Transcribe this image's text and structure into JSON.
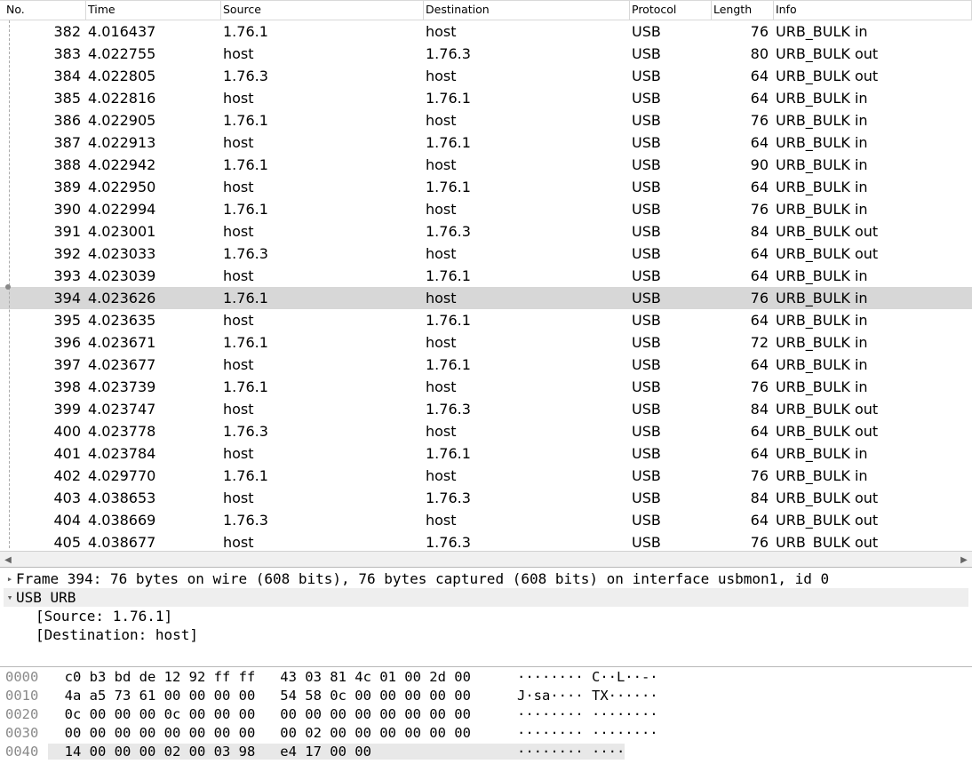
{
  "columns": {
    "no": "No.",
    "time": "Time",
    "source": "Source",
    "destination": "Destination",
    "protocol": "Protocol",
    "length": "Length",
    "info": "Info"
  },
  "selected_no": 394,
  "packets": [
    {
      "no": 382,
      "time": "4.016437",
      "src": "1.76.1",
      "dst": "host",
      "proto": "USB",
      "len": 76,
      "info": "URB_BULK in"
    },
    {
      "no": 383,
      "time": "4.022755",
      "src": "host",
      "dst": "1.76.3",
      "proto": "USB",
      "len": 80,
      "info": "URB_BULK out"
    },
    {
      "no": 384,
      "time": "4.022805",
      "src": "1.76.3",
      "dst": "host",
      "proto": "USB",
      "len": 64,
      "info": "URB_BULK out"
    },
    {
      "no": 385,
      "time": "4.022816",
      "src": "host",
      "dst": "1.76.1",
      "proto": "USB",
      "len": 64,
      "info": "URB_BULK in"
    },
    {
      "no": 386,
      "time": "4.022905",
      "src": "1.76.1",
      "dst": "host",
      "proto": "USB",
      "len": 76,
      "info": "URB_BULK in"
    },
    {
      "no": 387,
      "time": "4.022913",
      "src": "host",
      "dst": "1.76.1",
      "proto": "USB",
      "len": 64,
      "info": "URB_BULK in"
    },
    {
      "no": 388,
      "time": "4.022942",
      "src": "1.76.1",
      "dst": "host",
      "proto": "USB",
      "len": 90,
      "info": "URB_BULK in"
    },
    {
      "no": 389,
      "time": "4.022950",
      "src": "host",
      "dst": "1.76.1",
      "proto": "USB",
      "len": 64,
      "info": "URB_BULK in"
    },
    {
      "no": 390,
      "time": "4.022994",
      "src": "1.76.1",
      "dst": "host",
      "proto": "USB",
      "len": 76,
      "info": "URB_BULK in"
    },
    {
      "no": 391,
      "time": "4.023001",
      "src": "host",
      "dst": "1.76.3",
      "proto": "USB",
      "len": 84,
      "info": "URB_BULK out"
    },
    {
      "no": 392,
      "time": "4.023033",
      "src": "1.76.3",
      "dst": "host",
      "proto": "USB",
      "len": 64,
      "info": "URB_BULK out"
    },
    {
      "no": 393,
      "time": "4.023039",
      "src": "host",
      "dst": "1.76.1",
      "proto": "USB",
      "len": 64,
      "info": "URB_BULK in"
    },
    {
      "no": 394,
      "time": "4.023626",
      "src": "1.76.1",
      "dst": "host",
      "proto": "USB",
      "len": 76,
      "info": "URB_BULK in"
    },
    {
      "no": 395,
      "time": "4.023635",
      "src": "host",
      "dst": "1.76.1",
      "proto": "USB",
      "len": 64,
      "info": "URB_BULK in"
    },
    {
      "no": 396,
      "time": "4.023671",
      "src": "1.76.1",
      "dst": "host",
      "proto": "USB",
      "len": 72,
      "info": "URB_BULK in"
    },
    {
      "no": 397,
      "time": "4.023677",
      "src": "host",
      "dst": "1.76.1",
      "proto": "USB",
      "len": 64,
      "info": "URB_BULK in"
    },
    {
      "no": 398,
      "time": "4.023739",
      "src": "1.76.1",
      "dst": "host",
      "proto": "USB",
      "len": 76,
      "info": "URB_BULK in"
    },
    {
      "no": 399,
      "time": "4.023747",
      "src": "host",
      "dst": "1.76.3",
      "proto": "USB",
      "len": 84,
      "info": "URB_BULK out"
    },
    {
      "no": 400,
      "time": "4.023778",
      "src": "1.76.3",
      "dst": "host",
      "proto": "USB",
      "len": 64,
      "info": "URB_BULK out"
    },
    {
      "no": 401,
      "time": "4.023784",
      "src": "host",
      "dst": "1.76.1",
      "proto": "USB",
      "len": 64,
      "info": "URB_BULK in"
    },
    {
      "no": 402,
      "time": "4.029770",
      "src": "1.76.1",
      "dst": "host",
      "proto": "USB",
      "len": 76,
      "info": "URB_BULK in"
    },
    {
      "no": 403,
      "time": "4.038653",
      "src": "host",
      "dst": "1.76.3",
      "proto": "USB",
      "len": 84,
      "info": "URB_BULK out"
    },
    {
      "no": 404,
      "time": "4.038669",
      "src": "1.76.3",
      "dst": "host",
      "proto": "USB",
      "len": 64,
      "info": "URB_BULK out"
    },
    {
      "no": 405,
      "time": "4.038677",
      "src": "host",
      "dst": "1.76.3",
      "proto": "USB",
      "len": 76,
      "info": "URB_BULK out"
    }
  ],
  "details": {
    "frame_line": "Frame 394: 76 bytes on wire (608 bits), 76 bytes captured (608 bits) on interface usbmon1, id 0",
    "usb_urb": "USB URB",
    "source": "[Source: 1.76.1]",
    "destination": "[Destination: host]"
  },
  "hex": [
    {
      "off": "0000",
      "bytes": "c0 b3 bd de 12 92 ff ff   43 03 81 4c 01 00 2d 00",
      "ascii": "········ C··L··-·"
    },
    {
      "off": "0010",
      "bytes": "4a a5 73 61 00 00 00 00   54 58 0c 00 00 00 00 00",
      "ascii": "J·sa···· TX······"
    },
    {
      "off": "0020",
      "bytes": "0c 00 00 00 0c 00 00 00   00 00 00 00 00 00 00 00",
      "ascii": "········ ········"
    },
    {
      "off": "0030",
      "bytes": "00 00 00 00 00 00 00 00   00 02 00 00 00 00 00 00",
      "ascii": "········ ········"
    },
    {
      "off": "0040",
      "bytes": "14 00 00 00 02 00 03 98   e4 17 00 00",
      "ascii": "········ ····"
    }
  ]
}
